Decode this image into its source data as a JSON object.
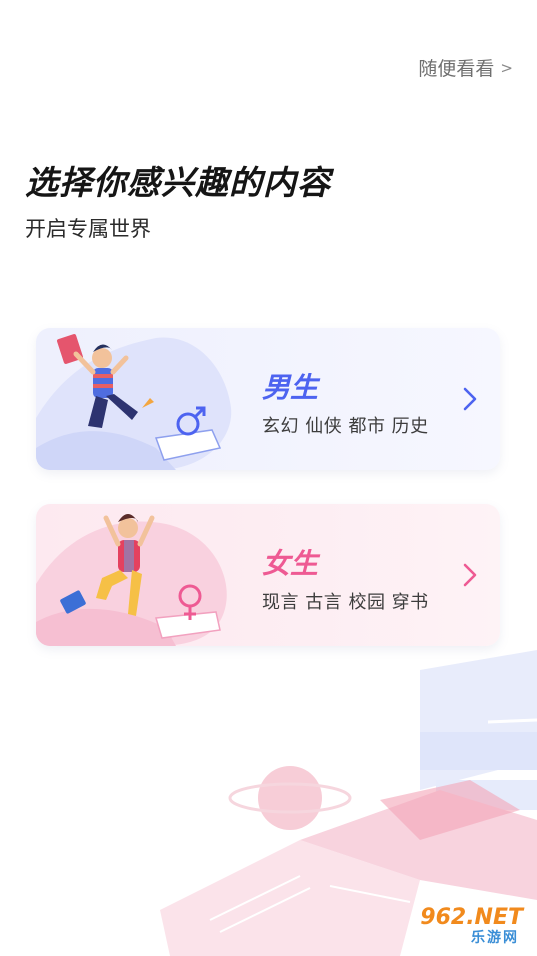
{
  "header": {
    "skip_label": "随便看看",
    "skip_chevron": ">"
  },
  "intro": {
    "title": "选择你感兴趣的内容",
    "subtitle": "开启专属世界"
  },
  "options": [
    {
      "label": "男生",
      "genres": "玄幻 仙侠 都市 历史",
      "accent": "#4d63f0",
      "icon": "male-symbol-icon"
    },
    {
      "label": "女生",
      "genres": "现言 古言 校园 穿书",
      "accent": "#ee5a93",
      "icon": "female-symbol-icon"
    }
  ],
  "watermark": {
    "main": "962.NET",
    "sub": "乐游网"
  }
}
